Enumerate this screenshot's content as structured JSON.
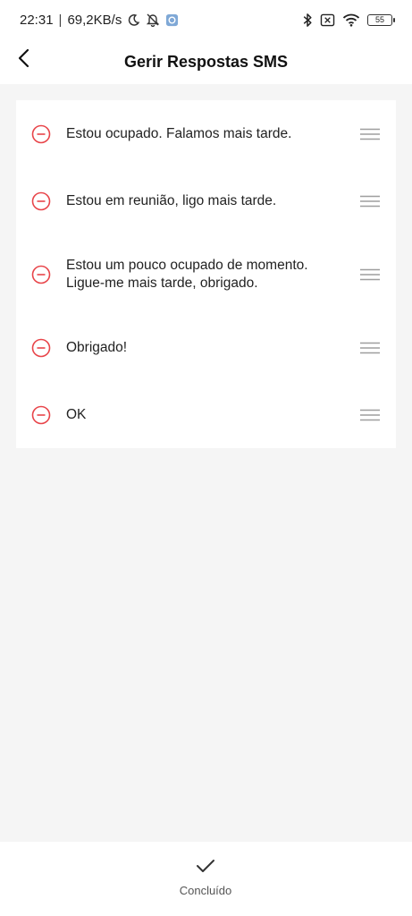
{
  "status_bar": {
    "time": "22:31",
    "separator": "|",
    "net_speed": "69,2KB/s",
    "battery": "55"
  },
  "header": {
    "title": "Gerir Respostas SMS"
  },
  "responses": [
    {
      "text": "Estou ocupado. Falamos mais tarde."
    },
    {
      "text": "Estou em reunião, ligo mais tarde."
    },
    {
      "text": "Estou um pouco ocupado de momento. Ligue-me mais tarde, obrigado."
    },
    {
      "text": "Obrigado!"
    },
    {
      "text": "OK"
    }
  ],
  "footer": {
    "done_label": "Concluído"
  },
  "colors": {
    "accent_red": "#e8454a",
    "handle_gray": "#9e9e9e",
    "background": "#f5f5f5"
  },
  "icons": [
    "moon-icon",
    "bell-off-icon",
    "app-notification-icon",
    "bluetooth-icon",
    "sim-off-icon",
    "wifi-icon",
    "battery-icon",
    "back-arrow-icon",
    "remove-circle-icon",
    "drag-handle-icon",
    "check-icon"
  ]
}
